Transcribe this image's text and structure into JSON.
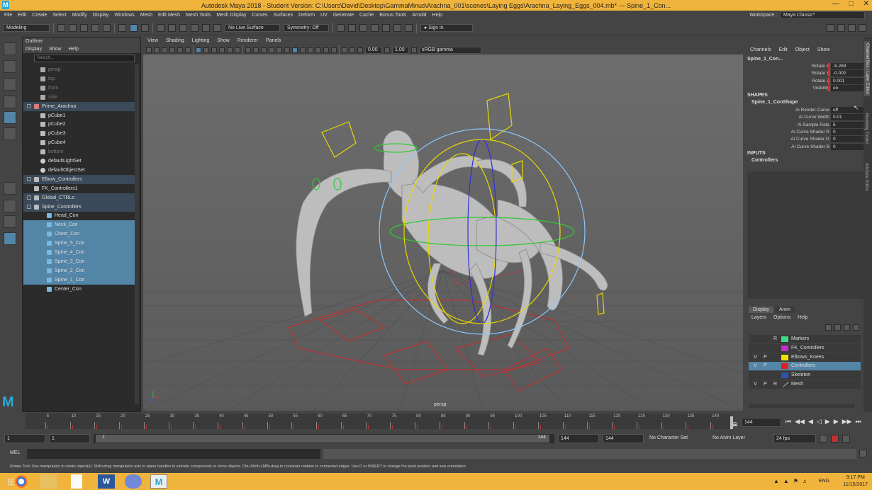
{
  "window": {
    "title": "Autodesk Maya 2018 - Student Version: C:\\Users\\David\\Desktop\\GammaMinus\\Arachna_001\\scenes\\Laying Eggs\\Arachna_Laying_Eggs_004.mb* --- Spine_1_Con..."
  },
  "menubar": {
    "items": [
      "File",
      "Edit",
      "Create",
      "Select",
      "Modify",
      "Display",
      "Windows",
      "Mesh",
      "Edit Mesh",
      "Mesh Tools",
      "Mesh Display",
      "Curves",
      "Surfaces",
      "Deform",
      "UV",
      "Generate",
      "Cache",
      "Bonus Tools",
      "Arnold",
      "Help"
    ],
    "workspace_label": "Workspace :",
    "workspace_value": "Maya Classic*"
  },
  "statusline": {
    "mode": "Modeling",
    "live_surface": "No Live Surface",
    "symmetry": "Symmetry: Off",
    "signin": "Sign in"
  },
  "outliner": {
    "title": "Outliner",
    "menu": [
      "Display",
      "Show",
      "Help"
    ],
    "search_placeholder": "Search...",
    "items": [
      {
        "label": "persp",
        "indent": 2,
        "dim": true,
        "icon": "camera"
      },
      {
        "label": "top",
        "indent": 2,
        "dim": true,
        "icon": "camera"
      },
      {
        "label": "front",
        "indent": 2,
        "dim": true,
        "icon": "camera"
      },
      {
        "label": "side",
        "indent": 2,
        "dim": true,
        "icon": "camera"
      },
      {
        "label": "Prime_Arachna",
        "indent": 1,
        "grp": true,
        "icon": "mesh"
      },
      {
        "label": "pCube1",
        "indent": 2,
        "icon": "transform"
      },
      {
        "label": "pCube2",
        "indent": 2,
        "icon": "transform"
      },
      {
        "label": "pCube3",
        "indent": 2,
        "icon": "transform"
      },
      {
        "label": "pCube4",
        "indent": 2,
        "icon": "transform"
      },
      {
        "label": "bottom",
        "indent": 2,
        "dim": true,
        "icon": "transform"
      },
      {
        "label": "defaultLightSet",
        "indent": 2,
        "icon": "set"
      },
      {
        "label": "defaultObjectSet",
        "indent": 2,
        "icon": "set"
      },
      {
        "label": "Elbow_Controllers",
        "indent": 1,
        "grp": true,
        "icon": "transform"
      },
      {
        "label": "FK_Controllers1",
        "indent": 1,
        "icon": "transform"
      },
      {
        "label": "Global_CTRLs",
        "indent": 1,
        "grp": true,
        "icon": "transform"
      },
      {
        "label": "Spine_Controllers",
        "indent": 1,
        "grp": true,
        "icon": "transform"
      },
      {
        "label": "Head_Con",
        "indent": 3,
        "icon": "curve"
      },
      {
        "label": "Neck_Con",
        "indent": 3,
        "sel": true,
        "icon": "curve"
      },
      {
        "label": "Chest_Con",
        "indent": 3,
        "sel": true,
        "icon": "curve"
      },
      {
        "label": "Spine_5_Con",
        "indent": 3,
        "sel": true,
        "icon": "curve"
      },
      {
        "label": "Spine_4_Con",
        "indent": 3,
        "sel": true,
        "icon": "curve"
      },
      {
        "label": "Spine_3_Con",
        "indent": 3,
        "sel": true,
        "icon": "curve"
      },
      {
        "label": "Spine_2_Con",
        "indent": 3,
        "sel": true,
        "icon": "curve"
      },
      {
        "label": "Spine_1_Con",
        "indent": 3,
        "sel": true,
        "icon": "curve"
      },
      {
        "label": "Center_Con",
        "indent": 3,
        "icon": "curve"
      }
    ]
  },
  "viewport": {
    "menu": [
      "View",
      "Shading",
      "Lighting",
      "Show",
      "Renderer",
      "Panels"
    ],
    "exposure": "0.00",
    "gamma": "1.00",
    "colorspace": "sRGB gamma",
    "camera_label": "persp"
  },
  "channelbox": {
    "menu": [
      "Channels",
      "Edit",
      "Object",
      "Show"
    ],
    "object": "Spine_1_Con...",
    "channels": [
      {
        "label": "Rotate X",
        "value": "-5.269"
      },
      {
        "label": "Rotate Y",
        "value": "-0.002"
      },
      {
        "label": "Rotate Z",
        "value": "0.001"
      },
      {
        "label": "Visibility",
        "value": "on"
      }
    ],
    "shapes_header": "SHAPES",
    "shape_name": "Spine_1_ConShape",
    "shape_attrs": [
      {
        "label": "Ai Render Curve",
        "value": "off"
      },
      {
        "label": "Ai Curve Width",
        "value": "0.01"
      },
      {
        "label": "Ai Sample Rate",
        "value": "5"
      },
      {
        "label": "Ai Curve Shader R",
        "value": "0"
      },
      {
        "label": "Ai Curve Shader G",
        "value": "0"
      },
      {
        "label": "Ai Curve Shader B",
        "value": "0"
      }
    ],
    "inputs_header": "INPUTS",
    "input_name": "Controllers"
  },
  "layers": {
    "tabs": [
      "Display",
      "Anim"
    ],
    "menu": [
      "Layers",
      "Options",
      "Help"
    ],
    "rows": [
      {
        "v": "",
        "p": "",
        "r": "R",
        "name": "Markers",
        "color": "#3fd98a"
      },
      {
        "v": "",
        "p": "",
        "r": "",
        "name": "FK_Controllers",
        "color": "#c030d0"
      },
      {
        "v": "V",
        "p": "P",
        "r": "",
        "name": "Elbows_Knees",
        "color": "#f0e000"
      },
      {
        "v": "V",
        "p": "P",
        "r": "",
        "name": "Controllers",
        "color": "#e02020",
        "sel": true
      },
      {
        "v": "",
        "p": "",
        "r": "",
        "name": "Skeleton",
        "color": "#3050b0"
      },
      {
        "v": "V",
        "p": "P",
        "r": "R",
        "name": "Mesh",
        "color": ""
      }
    ]
  },
  "sidetabs": [
    "Channel Box / Layer Editor",
    "Modeling Toolkit",
    "Attribute Editor"
  ],
  "timeline": {
    "ticks": [
      "5",
      "10",
      "15",
      "20",
      "25",
      "30",
      "35",
      "40",
      "45",
      "50",
      "55",
      "60",
      "65",
      "70",
      "75",
      "80",
      "85",
      "90",
      "95",
      "100",
      "105",
      "110",
      "115",
      "120",
      "125",
      "130",
      "135",
      "140"
    ],
    "current_frame": "144",
    "end_label": "144"
  },
  "range": {
    "start": "1",
    "playback_start": "1",
    "slider_start": "1",
    "slider_end": "144",
    "playback_end": "144",
    "end": "144",
    "char_set": "No Character Set",
    "anim_layer": "No Anim Layer",
    "fps": "24 fps"
  },
  "mel": {
    "label": "MEL"
  },
  "help": {
    "text": "Rotate Tool: Use manipulator to rotate object(s). Shift+drag manipulator axis or plane handles to extrude components or clone objects. Ctrl+Shift+LMB+drag to constrain rotation to connected edges. Use D or INSERT to change the pivot position and axis orientation."
  },
  "taskbar": {
    "time": "9:17 PM",
    "date": "11/15/2017",
    "lang": "ENG"
  },
  "colors": {
    "accent": "#f0b43c",
    "selection": "#5285a6",
    "panel": "#444444"
  }
}
